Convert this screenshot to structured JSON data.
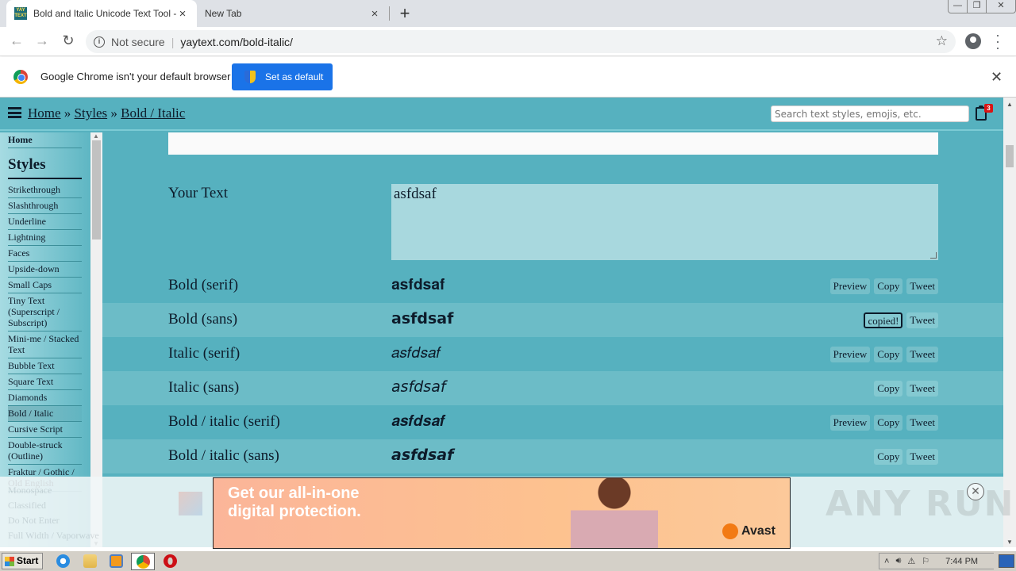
{
  "browser": {
    "tabs": [
      {
        "title": "Bold and Italic Unicode Text Tool - B",
        "favicon": "YAY TEXT",
        "active": true
      },
      {
        "title": "New Tab",
        "active": false
      }
    ],
    "new_tab_icon": "+",
    "window_controls": {
      "minimize": "—",
      "restore": "❐",
      "close": "✕"
    },
    "security_label": "Not secure",
    "url": "yaytext.com/bold-italic/",
    "infobar": {
      "message": "Google Chrome isn't your default browser",
      "button": "Set as default"
    }
  },
  "site": {
    "breadcrumb": [
      {
        "label": "Home"
      },
      {
        "label": "Styles"
      },
      {
        "label": "Bold / Italic"
      }
    ],
    "breadcrumb_sep": "»",
    "search_placeholder": "Search text styles, emojis, etc.",
    "clipboard_count": "3",
    "sidebar": {
      "home": "Home",
      "styles_heading": "Styles",
      "items": [
        {
          "label": "Strikethrough"
        },
        {
          "label": "Slashthrough"
        },
        {
          "label": "Underline"
        },
        {
          "label": "Lightning"
        },
        {
          "label": "Faces"
        },
        {
          "label": "Upside-down"
        },
        {
          "label": "Small Caps"
        },
        {
          "label": "Tiny Text (Superscript / Subscript)"
        },
        {
          "label": "Mini-me / Stacked Text"
        },
        {
          "label": "Bubble Text"
        },
        {
          "label": "Square Text"
        },
        {
          "label": "Diamonds"
        },
        {
          "label": "Bold / Italic",
          "active": true
        },
        {
          "label": "Cursive Script"
        },
        {
          "label": "Double-struck (Outline)"
        },
        {
          "label": "Fraktur / Gothic / Old English"
        }
      ],
      "hidden_items": [
        "Monospace",
        "Classified",
        "Do Not Enter",
        "Full Width / Vaporwave"
      ]
    },
    "your_text_label": "Your Text",
    "your_text_value": "asfdsaf",
    "rows": [
      {
        "label": "Bold (serif)",
        "output": "𝐚𝐬𝐟𝐝𝐬𝐚𝐟",
        "buttons": [
          "Preview",
          "Copy",
          "Tweet"
        ]
      },
      {
        "label": "Bold (sans)",
        "output": "𝗮𝘀𝗳𝗱𝘀𝗮𝗳",
        "buttons": [
          "copied!",
          "Tweet"
        ],
        "copied": true
      },
      {
        "label": "Italic (serif)",
        "output": "𝑎𝑠𝑓𝑑𝑠𝑎𝑓",
        "buttons": [
          "Preview",
          "Copy",
          "Tweet"
        ]
      },
      {
        "label": "Italic (sans)",
        "output": "𝘢𝘴𝘧𝘥𝘴𝘢𝘧",
        "buttons": [
          "Copy",
          "Tweet"
        ]
      },
      {
        "label": "Bold / italic (serif)",
        "output": "𝒂𝒔𝒇𝒅𝒔𝒂𝒇",
        "buttons": [
          "Preview",
          "Copy",
          "Tweet"
        ]
      },
      {
        "label": "Bold / italic (sans)",
        "output": "𝙖𝙨𝙛𝙙𝙨𝙖𝙛",
        "buttons": [
          "Copy",
          "Tweet"
        ]
      }
    ]
  },
  "ad": {
    "headline_line1": "Get our all-in-one",
    "headline_line2": "digital protection.",
    "brand": "Avast",
    "close_icon": "✕"
  },
  "watermark": "ANY RUN",
  "taskbar": {
    "start_label": "Start",
    "clock": "7:44 PM"
  },
  "colors": {
    "page_bg": "#56b1bf",
    "alt_row": "#6cbcc7",
    "text_dark": "#0d1b2a",
    "chrome_blue": "#1a73e8"
  }
}
